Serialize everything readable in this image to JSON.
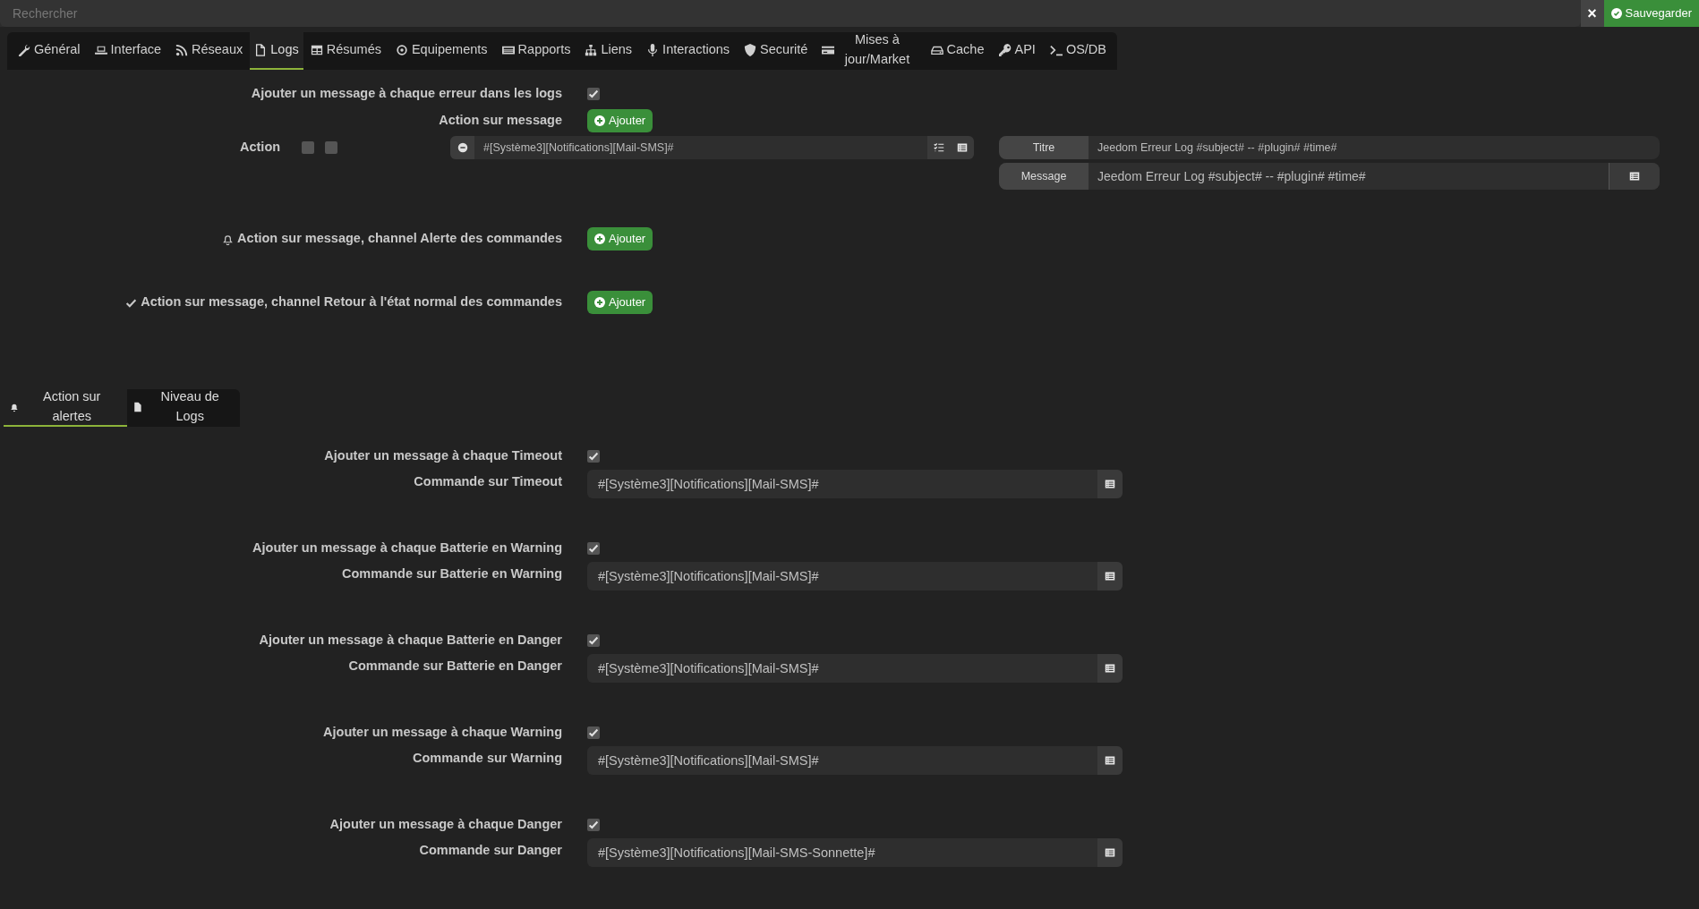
{
  "search": {
    "placeholder": "Rechercher"
  },
  "close_button": {
    "label": "×"
  },
  "save_button": {
    "label": "Sauvegarder"
  },
  "tabs": [
    {
      "label": "Général",
      "selected": false
    },
    {
      "label": "Interface",
      "selected": false
    },
    {
      "label": "Réseaux",
      "selected": false
    },
    {
      "label": "Logs",
      "selected": true
    },
    {
      "label": "Résumés",
      "selected": false
    },
    {
      "label": "Equipements",
      "selected": false
    },
    {
      "label": "Rapports",
      "selected": false
    },
    {
      "label": "Liens",
      "selected": false
    },
    {
      "label": "Interactions",
      "selected": false
    },
    {
      "label": "Securité",
      "selected": false
    },
    {
      "label": "Mises à jour/Market",
      "selected": false
    },
    {
      "label": "Cache",
      "selected": false
    },
    {
      "label": "API",
      "selected": false
    },
    {
      "label": "OS/DB",
      "selected": false
    }
  ],
  "log_messages": {
    "error_label": "Ajouter un message à chaque erreur dans les logs",
    "error_checked": true,
    "action_label": "Action sur message",
    "add_button": "Ajouter",
    "action": {
      "label": "Action",
      "options": [
        {
          "checked": false
        },
        {
          "checked": false
        }
      ],
      "command": "#[Système3][Notifications][Mail-SMS]#",
      "title_label": "Titre",
      "title_value": "Jeedom  Erreur Log #subject# -- #plugin# #time#",
      "message_label": "Message",
      "message_value": "Jeedom  Erreur Log #subject# -- #plugin# #time#"
    },
    "channels": [
      {
        "kind": "alert",
        "label": "Action sur message, channel Alerte des commandes",
        "button": "Ajouter"
      },
      {
        "kind": "back",
        "label": "Action sur message, channel Retour à l'état normal des commandes",
        "button": "Ajouter"
      }
    ]
  },
  "subtabs": [
    {
      "label": "Action sur alertes",
      "selected": true
    },
    {
      "label": "Niveau de Logs",
      "selected": false
    }
  ],
  "alerts": [
    {
      "check_label": "Ajouter un message à chaque Timeout",
      "checked": true,
      "command_label": "Commande sur Timeout",
      "command": "#[Système3][Notifications][Mail-SMS]#"
    },
    {
      "check_label": "Ajouter un message à chaque Batterie en Warning",
      "checked": true,
      "command_label": "Commande sur Batterie en Warning",
      "command": "#[Système3][Notifications][Mail-SMS]#"
    },
    {
      "check_label": "Ajouter un message à chaque Batterie en Danger",
      "checked": true,
      "command_label": "Commande sur Batterie en Danger",
      "command": "#[Système3][Notifications][Mail-SMS]#"
    },
    {
      "check_label": "Ajouter un message à chaque Warning",
      "checked": true,
      "command_label": "Commande sur Warning",
      "command": "#[Système3][Notifications][Mail-SMS]#"
    },
    {
      "check_label": "Ajouter un message à chaque Danger",
      "checked": true,
      "command_label": "Commande sur Danger",
      "command": "#[Système3][Notifications][Mail-SMS-Sonnette]#"
    }
  ]
}
